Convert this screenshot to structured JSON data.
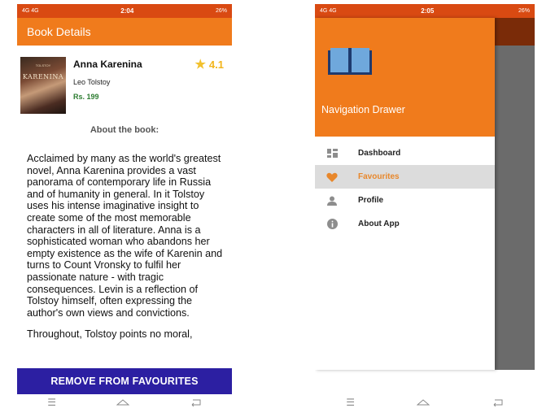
{
  "left_screen": {
    "status": {
      "left": "4G 4G",
      "time": "2:04",
      "right": "26%"
    },
    "app_bar_title": "Book Details",
    "book": {
      "cover_author": "TOLSTOY",
      "cover_title": "KARENINA",
      "title": "Anna Karenina",
      "author": "Leo Tolstoy",
      "price": "Rs. 199",
      "rating": "4.1"
    },
    "about_heading": "About the book:",
    "description_p1": "Acclaimed by many as the world's greatest novel, Anna Karenina provides a vast panorama of contemporary life in Russia and of humanity in general. In it Tolstoy uses his intense imaginative insight to create some of the most memorable characters in all of literature. Anna is a sophisticated woman who abandons her empty existence as the wife of Karenin and turns to Count Vronsky to fulfil her passionate nature - with tragic consequences. Levin is a reflection of Tolstoy himself, often expressing the author's own views and convictions.",
    "description_p2": "Throughout, Tolstoy points no moral,",
    "remove_button": "REMOVE FROM FAVOURITES"
  },
  "right_screen": {
    "status": {
      "left": "4G 4G",
      "time": "2:05",
      "right": "26%"
    },
    "drawer_title": "Navigation Drawer",
    "items": [
      {
        "label": "Dashboard",
        "icon": "dashboard-icon"
      },
      {
        "label": "Favourites",
        "icon": "heart-icon"
      },
      {
        "label": "Profile",
        "icon": "person-icon"
      },
      {
        "label": "About App",
        "icon": "info-icon"
      }
    ]
  },
  "colors": {
    "accent_orange": "#f07b1c",
    "status_orange": "#d94a12",
    "button_blue": "#2c1fa2",
    "price_green": "#2e7d32",
    "rating_gold": "#f2b51d"
  }
}
